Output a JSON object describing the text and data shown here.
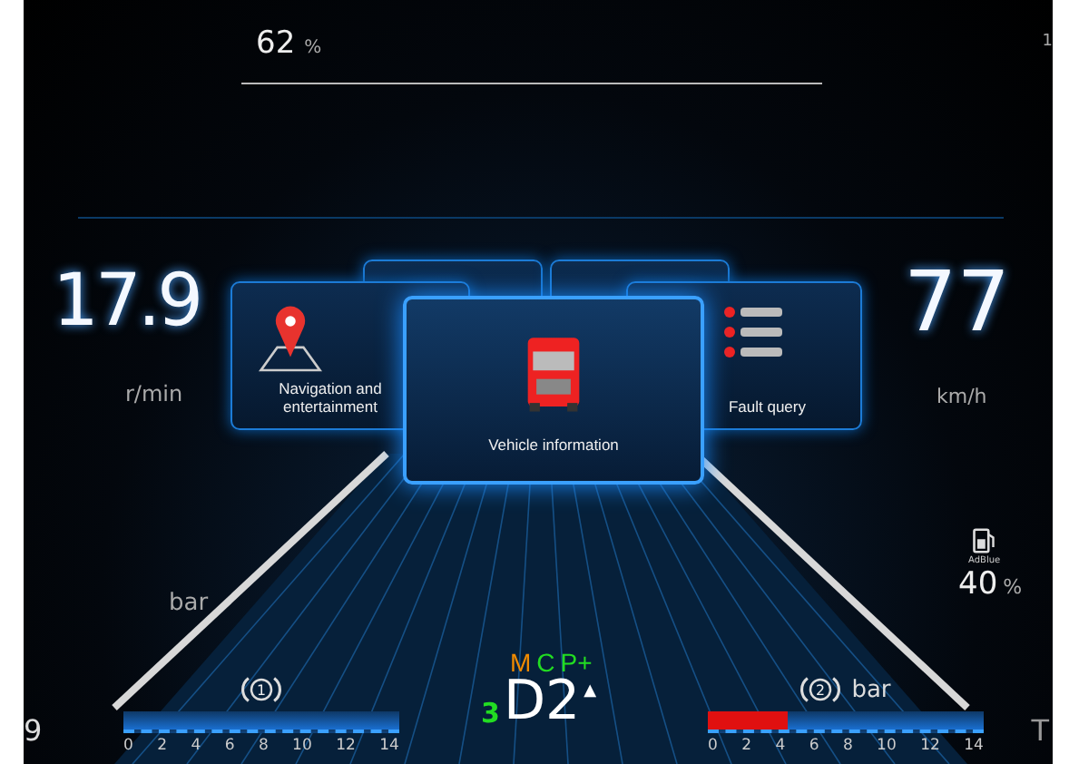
{
  "top_left_reading": {
    "value": "62",
    "unit": "%"
  },
  "top_right_edge": "1",
  "rpm": {
    "value": "17.9",
    "unit": "r/min"
  },
  "speed": {
    "value": "77",
    "unit": "km/h"
  },
  "menu": [
    {
      "kind": "navigation",
      "label": "Navigation and entertainment",
      "selected": false
    },
    {
      "kind": "vehicle",
      "label": "Vehicle information",
      "selected": true
    },
    {
      "kind": "fault",
      "label": "Fault query",
      "selected": false
    }
  ],
  "left_pressure": {
    "unit": "bar"
  },
  "gear": {
    "modes": [
      {
        "label": "M",
        "color": "#f08a00"
      },
      {
        "label": "C",
        "color": "#22dd22"
      },
      {
        "label": "P+",
        "color": "#22dd22"
      }
    ],
    "range": "3",
    "gear": "D2",
    "arrow": "▲"
  },
  "brake_gauges": [
    {
      "circuit": "1",
      "ticks": [
        "0",
        "2",
        "4",
        "6",
        "8",
        "10",
        "12",
        "14"
      ]
    },
    {
      "circuit": "2",
      "unit": "bar",
      "level": 0.29,
      "ticks": [
        "0",
        "2",
        "4",
        "6",
        "8",
        "10",
        "12",
        "14"
      ]
    }
  ],
  "adblue": {
    "label": "AdBlue",
    "value": "40",
    "unit": "%"
  },
  "left_edge": "9",
  "right_edge": "T"
}
